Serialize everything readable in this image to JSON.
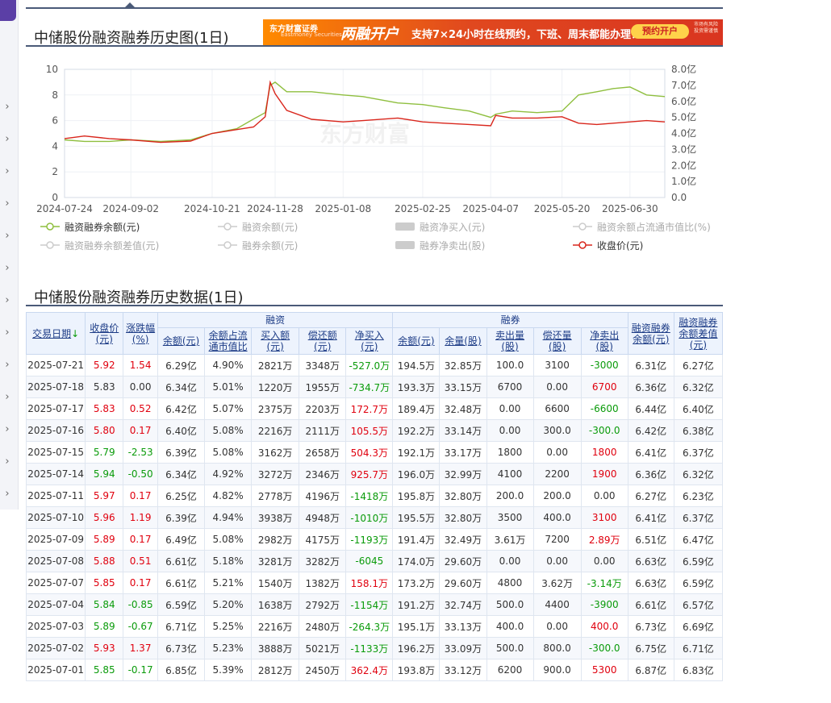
{
  "page": {
    "chart_title": "中储股份融资融券历史图(1日)",
    "table_title": "中储股份融资融券历史数据(1日)",
    "watermark": "东方财富"
  },
  "banner": {
    "brand": "东方财富证券",
    "brand_en": "Eastmoney Securities",
    "headline": "两融开户",
    "slogan": "支持7×24小时在线预约，下班、周末都能办理！",
    "button": "预约开户",
    "risk": "市场有风险 投资需谨慎"
  },
  "legend": [
    {
      "label": "融资融券余额(元)",
      "active": true,
      "color": "#8fbf3f",
      "shape": "line"
    },
    {
      "label": "融资余额(元)",
      "active": false,
      "shape": "line"
    },
    {
      "label": "融资净买入(元)",
      "active": false,
      "shape": "rect"
    },
    {
      "label": "融资余额占流通市值比(%)",
      "active": false,
      "shape": "line"
    },
    {
      "label": "融资融券余额差值(元)",
      "active": false,
      "shape": "line"
    },
    {
      "label": "融券余额(元)",
      "active": false,
      "shape": "line"
    },
    {
      "label": "融券净卖出(股)",
      "active": false,
      "shape": "rect"
    },
    {
      "label": "收盘价(元)",
      "active": true,
      "color": "#d9261c",
      "shape": "line"
    }
  ],
  "chart_data": {
    "type": "line",
    "x_tick_labels": [
      "2024-07-24",
      "2024-09-02",
      "2024-10-21",
      "2024-11-28",
      "2025-01-08",
      "2025-02-25",
      "2025-04-07",
      "2025-05-20",
      "2025-06-30"
    ],
    "y_left_ticks": [
      "0",
      "2",
      "4",
      "6",
      "8",
      "10"
    ],
    "y_left_range": [
      0,
      10
    ],
    "y_right_ticks": [
      "0.0",
      "1.0亿",
      "2.0亿",
      "3.0亿",
      "4.0亿",
      "5.0亿",
      "6.0亿",
      "7.0亿",
      "8.0亿"
    ],
    "y_right_range": [
      0,
      8
    ],
    "grid": true,
    "series": [
      {
        "name": "融资融券余额(元)",
        "axis": "right",
        "color": "#8fbf3f",
        "x": [
          "2024-07-24",
          "2024-08-05",
          "2024-08-20",
          "2024-09-02",
          "2024-09-20",
          "2024-10-08",
          "2024-10-21",
          "2024-11-05",
          "2024-11-15",
          "2024-11-22",
          "2024-11-25",
          "2024-11-28",
          "2024-12-05",
          "2024-12-20",
          "2025-01-08",
          "2025-01-20",
          "2025-02-10",
          "2025-02-25",
          "2025-03-10",
          "2025-03-25",
          "2025-04-07",
          "2025-04-10",
          "2025-04-20",
          "2025-05-05",
          "2025-05-20",
          "2025-05-30",
          "2025-06-10",
          "2025-06-20",
          "2025-06-30",
          "2025-07-10",
          "2025-07-21"
        ],
        "y": [
          3.6,
          3.5,
          3.5,
          3.6,
          3.5,
          3.6,
          4.0,
          4.3,
          4.9,
          5.3,
          7.0,
          7.2,
          6.6,
          6.6,
          6.4,
          6.3,
          5.9,
          5.8,
          5.6,
          5.4,
          5.0,
          5.2,
          5.4,
          5.3,
          5.4,
          6.4,
          6.6,
          6.8,
          6.9,
          6.4,
          6.3
        ]
      },
      {
        "name": "收盘价(元)",
        "axis": "left",
        "color": "#d9261c",
        "x": [
          "2024-07-24",
          "2024-08-05",
          "2024-08-20",
          "2024-09-02",
          "2024-09-20",
          "2024-10-08",
          "2024-10-21",
          "2024-11-05",
          "2024-11-15",
          "2024-11-22",
          "2024-11-25",
          "2024-11-28",
          "2024-12-05",
          "2024-12-20",
          "2025-01-08",
          "2025-01-20",
          "2025-02-10",
          "2025-02-25",
          "2025-03-10",
          "2025-03-25",
          "2025-04-07",
          "2025-04-10",
          "2025-04-20",
          "2025-05-05",
          "2025-05-20",
          "2025-05-30",
          "2025-06-10",
          "2025-06-20",
          "2025-06-30",
          "2025-07-10",
          "2025-07-21"
        ],
        "y": [
          4.6,
          4.8,
          4.6,
          4.5,
          4.3,
          4.4,
          5.0,
          5.3,
          5.5,
          6.3,
          9.0,
          8.1,
          6.8,
          6.1,
          5.9,
          6.0,
          6.2,
          5.9,
          5.8,
          5.7,
          5.6,
          6.4,
          6.2,
          6.2,
          6.3,
          5.8,
          5.7,
          5.8,
          5.9,
          6.0,
          5.9
        ]
      }
    ]
  },
  "table": {
    "group_headers": {
      "rz": "融资",
      "rq": "融券"
    },
    "col_headers": {
      "date": "交易日期",
      "close": "收盘价(元)",
      "chg": "涨跌幅(%)",
      "rz_bal": "余额(元)",
      "rz_ratio": "余额占流通市值比",
      "rz_buy": "买入额(元)",
      "rz_repay": "偿还额(元)",
      "rz_net": "净买入(元)",
      "rq_bal": "余额(元)",
      "rq_vol": "余量(股)",
      "rq_sell": "卖出量(股)",
      "rq_repay": "偿还量(股)",
      "rq_net": "净卖出(股)",
      "total": "融资融券余额(元)",
      "diff": "融资融券余额差值(元)"
    },
    "sort_indicator": "↓",
    "rows": [
      [
        "2025-07-21",
        "5.92",
        "1.54",
        "6.29亿",
        "4.90%",
        "2821万",
        "3348万",
        "-527.0万",
        "194.5万",
        "32.85万",
        "100.0",
        "3100",
        "-3000",
        "6.31亿",
        "6.27亿"
      ],
      [
        "2025-07-18",
        "5.83",
        "0.00",
        "6.34亿",
        "5.01%",
        "1220万",
        "1955万",
        "-734.7万",
        "193.3万",
        "33.15万",
        "6700",
        "0.00",
        "6700",
        "6.36亿",
        "6.32亿"
      ],
      [
        "2025-07-17",
        "5.83",
        "0.52",
        "6.42亿",
        "5.07%",
        "2375万",
        "2203万",
        "172.7万",
        "189.4万",
        "32.48万",
        "0.00",
        "6600",
        "-6600",
        "6.44亿",
        "6.40亿"
      ],
      [
        "2025-07-16",
        "5.80",
        "0.17",
        "6.40亿",
        "5.08%",
        "2216万",
        "2111万",
        "105.5万",
        "192.2万",
        "33.14万",
        "0.00",
        "300.0",
        "-300.0",
        "6.42亿",
        "6.38亿"
      ],
      [
        "2025-07-15",
        "5.79",
        "-2.53",
        "6.39亿",
        "5.08%",
        "3162万",
        "2658万",
        "504.3万",
        "192.1万",
        "33.17万",
        "1800",
        "0.00",
        "1800",
        "6.41亿",
        "6.37亿"
      ],
      [
        "2025-07-14",
        "5.94",
        "-0.50",
        "6.34亿",
        "4.92%",
        "3272万",
        "2346万",
        "925.7万",
        "196.0万",
        "32.99万",
        "4100",
        "2200",
        "1900",
        "6.36亿",
        "6.32亿"
      ],
      [
        "2025-07-11",
        "5.97",
        "0.17",
        "6.25亿",
        "4.82%",
        "2778万",
        "4196万",
        "-1418万",
        "195.8万",
        "32.80万",
        "200.0",
        "200.0",
        "0.00",
        "6.27亿",
        "6.23亿"
      ],
      [
        "2025-07-10",
        "5.96",
        "1.19",
        "6.39亿",
        "4.94%",
        "3938万",
        "4948万",
        "-1010万",
        "195.5万",
        "32.80万",
        "3500",
        "400.0",
        "3100",
        "6.41亿",
        "6.37亿"
      ],
      [
        "2025-07-09",
        "5.89",
        "0.17",
        "6.49亿",
        "5.08%",
        "2982万",
        "4175万",
        "-1193万",
        "191.4万",
        "32.49万",
        "3.61万",
        "7200",
        "2.89万",
        "6.51亿",
        "6.47亿"
      ],
      [
        "2025-07-08",
        "5.88",
        "0.51",
        "6.61亿",
        "5.18%",
        "3281万",
        "3282万",
        "-6045",
        "174.0万",
        "29.60万",
        "0.00",
        "0.00",
        "0.00",
        "6.63亿",
        "6.59亿"
      ],
      [
        "2025-07-07",
        "5.85",
        "0.17",
        "6.61亿",
        "5.21%",
        "1540万",
        "1382万",
        "158.1万",
        "173.2万",
        "29.60万",
        "4800",
        "3.62万",
        "-3.14万",
        "6.63亿",
        "6.59亿"
      ],
      [
        "2025-07-04",
        "5.84",
        "-0.85",
        "6.59亿",
        "5.20%",
        "1638万",
        "2792万",
        "-1154万",
        "191.2万",
        "32.74万",
        "500.0",
        "4400",
        "-3900",
        "6.61亿",
        "6.57亿"
      ],
      [
        "2025-07-03",
        "5.89",
        "-0.67",
        "6.71亿",
        "5.25%",
        "2216万",
        "2480万",
        "-264.3万",
        "195.1万",
        "33.13万",
        "400.0",
        "0.00",
        "400.0",
        "6.73亿",
        "6.69亿"
      ],
      [
        "2025-07-02",
        "5.93",
        "1.37",
        "6.73亿",
        "5.23%",
        "3888万",
        "5021万",
        "-1133万",
        "196.2万",
        "33.09万",
        "500.0",
        "800.0",
        "-300.0",
        "6.75亿",
        "6.71亿"
      ],
      [
        "2025-07-01",
        "5.85",
        "-0.17",
        "6.85亿",
        "5.39%",
        "2812万",
        "2450万",
        "362.4万",
        "193.8万",
        "33.12万",
        "6200",
        "900.0",
        "5300",
        "6.87亿",
        "6.83亿"
      ]
    ]
  }
}
